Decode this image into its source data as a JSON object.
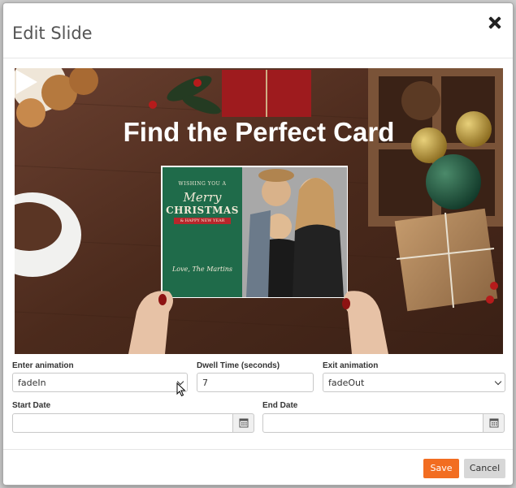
{
  "dialog": {
    "title": "Edit Slide",
    "close_icon": "close-icon"
  },
  "preview": {
    "headline": "Find the Perfect Card",
    "card": {
      "line1": "WISHING YOU A",
      "line2": "Merry",
      "line3": "CHRISTMAS",
      "line4": "& HAPPY NEW YEAR",
      "signature": "Love, The Martins"
    },
    "play_icon": "play-icon"
  },
  "form": {
    "enter_animation": {
      "label": "Enter animation",
      "value": "fadeIn"
    },
    "dwell_time": {
      "label": "Dwell Time (seconds)",
      "value": "7"
    },
    "exit_animation": {
      "label": "Exit animation",
      "value": "fadeOut"
    },
    "start_date": {
      "label": "Start Date",
      "value": "",
      "icon": "calendar-icon"
    },
    "end_date": {
      "label": "End Date",
      "value": "",
      "icon": "calendar-icon"
    }
  },
  "footer": {
    "save_label": "Save",
    "cancel_label": "Cancel"
  },
  "colors": {
    "primary_button": "#f26d21",
    "secondary_button": "#d7d7d7",
    "card_green": "#1f6b4a"
  }
}
